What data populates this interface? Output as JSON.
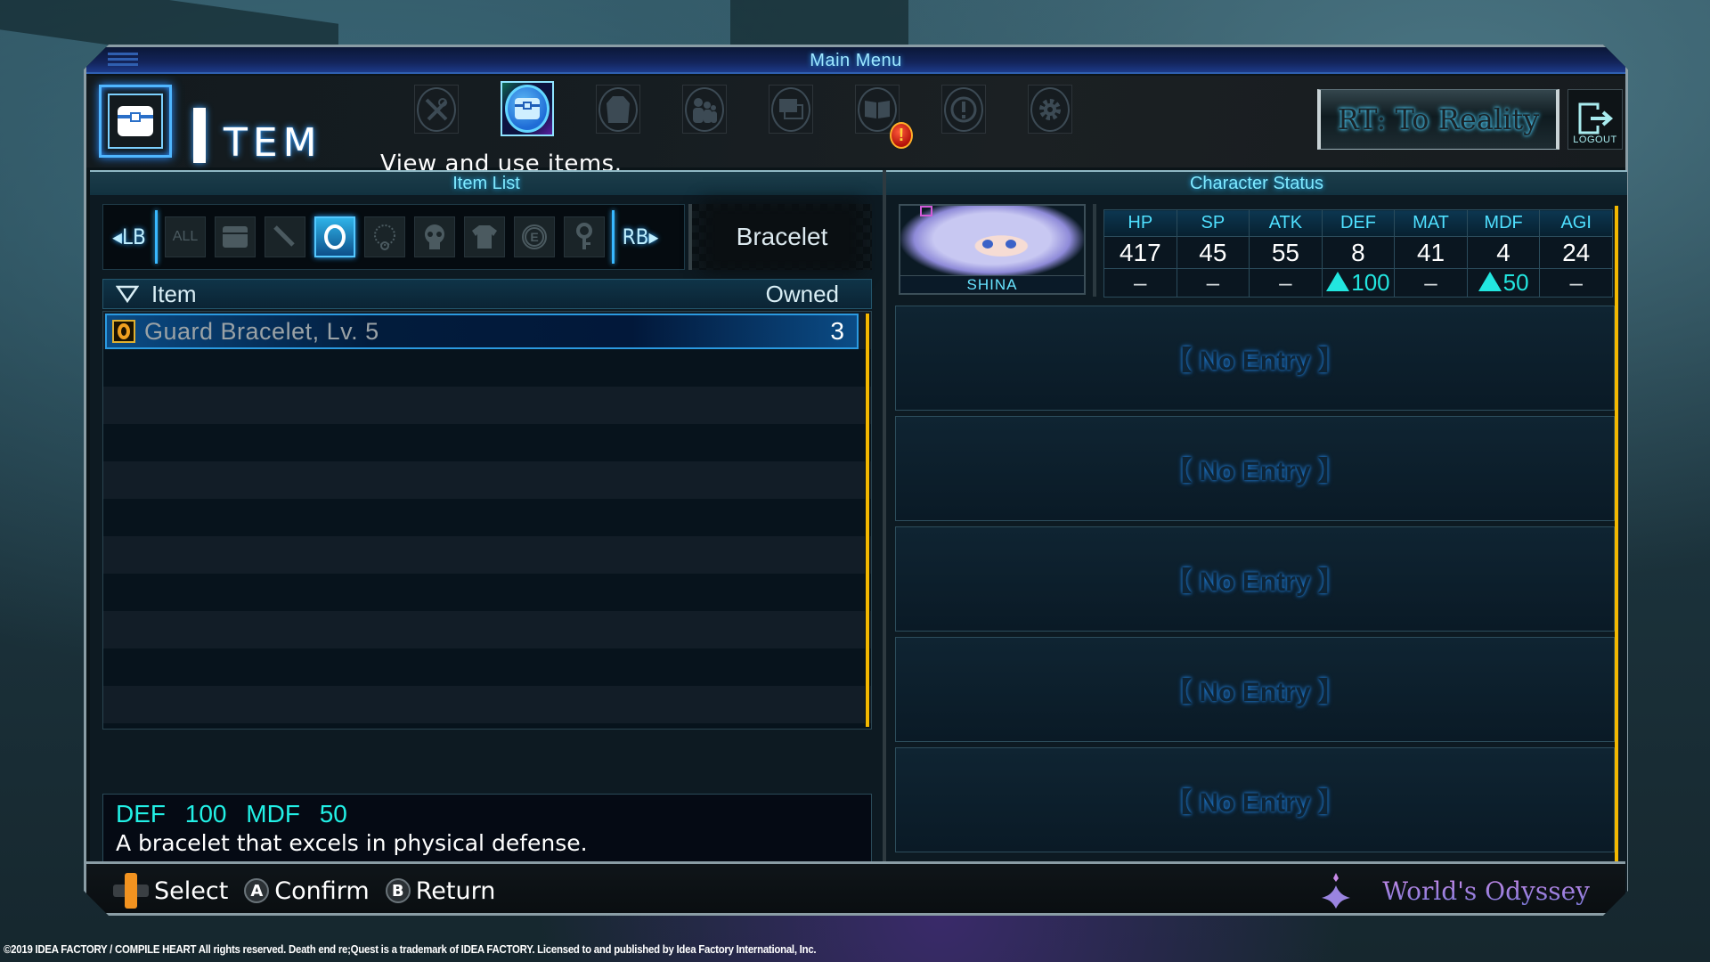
{
  "window": {
    "title": "Main Menu"
  },
  "header": {
    "section_title_rest": "TEM",
    "section_title_full": "Item",
    "caption": "View and use items.",
    "menu_icons": [
      {
        "name": "equip-skills-icon",
        "active": false
      },
      {
        "name": "item-chest-icon",
        "active": true
      },
      {
        "name": "equipment-coat-icon",
        "active": false
      },
      {
        "name": "party-icon",
        "active": false
      },
      {
        "name": "windows-icon",
        "active": false
      },
      {
        "name": "library-book-icon",
        "active": false,
        "alert": "!"
      },
      {
        "name": "notice-icon",
        "active": false
      },
      {
        "name": "settings-gear-icon",
        "active": false
      }
    ],
    "rt_button_label": "RT: To Reality",
    "logout_label": "LOGOUT"
  },
  "item_list": {
    "panel_title": "Item List",
    "lb_label": "LB",
    "rb_label": "RB",
    "categories": [
      {
        "name": "all",
        "label": "ALL",
        "active": false
      },
      {
        "name": "consumables",
        "label": "",
        "active": false
      },
      {
        "name": "weapons",
        "label": "",
        "active": false
      },
      {
        "name": "bracelet",
        "label": "",
        "active": true
      },
      {
        "name": "necklace",
        "label": "",
        "active": false
      },
      {
        "name": "skull",
        "label": "",
        "active": false
      },
      {
        "name": "clothes",
        "label": "",
        "active": false
      },
      {
        "name": "e-items",
        "label": "",
        "active": false
      },
      {
        "name": "key-items",
        "label": "",
        "active": false
      }
    ],
    "selected_category": "Bracelet",
    "column_item": "Item",
    "column_owned": "Owned",
    "rows": [
      {
        "name": "Guard Bracelet, Lv. 5",
        "owned": "3",
        "selected": true
      }
    ],
    "scroll_fraction_visible": 1.0,
    "description": {
      "stats": "DEF 100  MDF 50",
      "text": "A bracelet that excels in physical defense."
    }
  },
  "character_status": {
    "panel_title": "Character Status",
    "character_name": "SHINA",
    "stat_headers": [
      "HP",
      "SP",
      "ATK",
      "DEF",
      "MAT",
      "MDF",
      "AGI"
    ],
    "stat_values": [
      "417",
      "45",
      "55",
      "8",
      "41",
      "4",
      "24"
    ],
    "stat_deltas": [
      {
        "text": "–",
        "up": false
      },
      {
        "text": "–",
        "up": false
      },
      {
        "text": "–",
        "up": false
      },
      {
        "text": "100",
        "up": true
      },
      {
        "text": "–",
        "up": false
      },
      {
        "text": "50",
        "up": true
      },
      {
        "text": "–",
        "up": false
      }
    ],
    "empty_slots": [
      "【 No Entry 】",
      "【 No Entry 】",
      "【 No Entry 】",
      "【 No Entry 】",
      "【 No Entry 】"
    ]
  },
  "footer": {
    "controls": [
      {
        "button": "dpad",
        "label": "Select"
      },
      {
        "button": "A",
        "label": "Confirm"
      },
      {
        "button": "B",
        "label": "Return"
      }
    ],
    "world_name": "World's Odyssey"
  },
  "copyright": "©2019 IDEA FACTORY / COMPILE HEART All rights reserved. Death end re;Quest is a trademark of IDEA FACTORY. Licensed to and published by Idea Factory International, Inc.",
  "colors": {
    "accent_cyan": "#4fe0ff",
    "stat_up": "#22e6e0",
    "scrollbar": "#f3b800",
    "world_purple": "#b489e8"
  }
}
